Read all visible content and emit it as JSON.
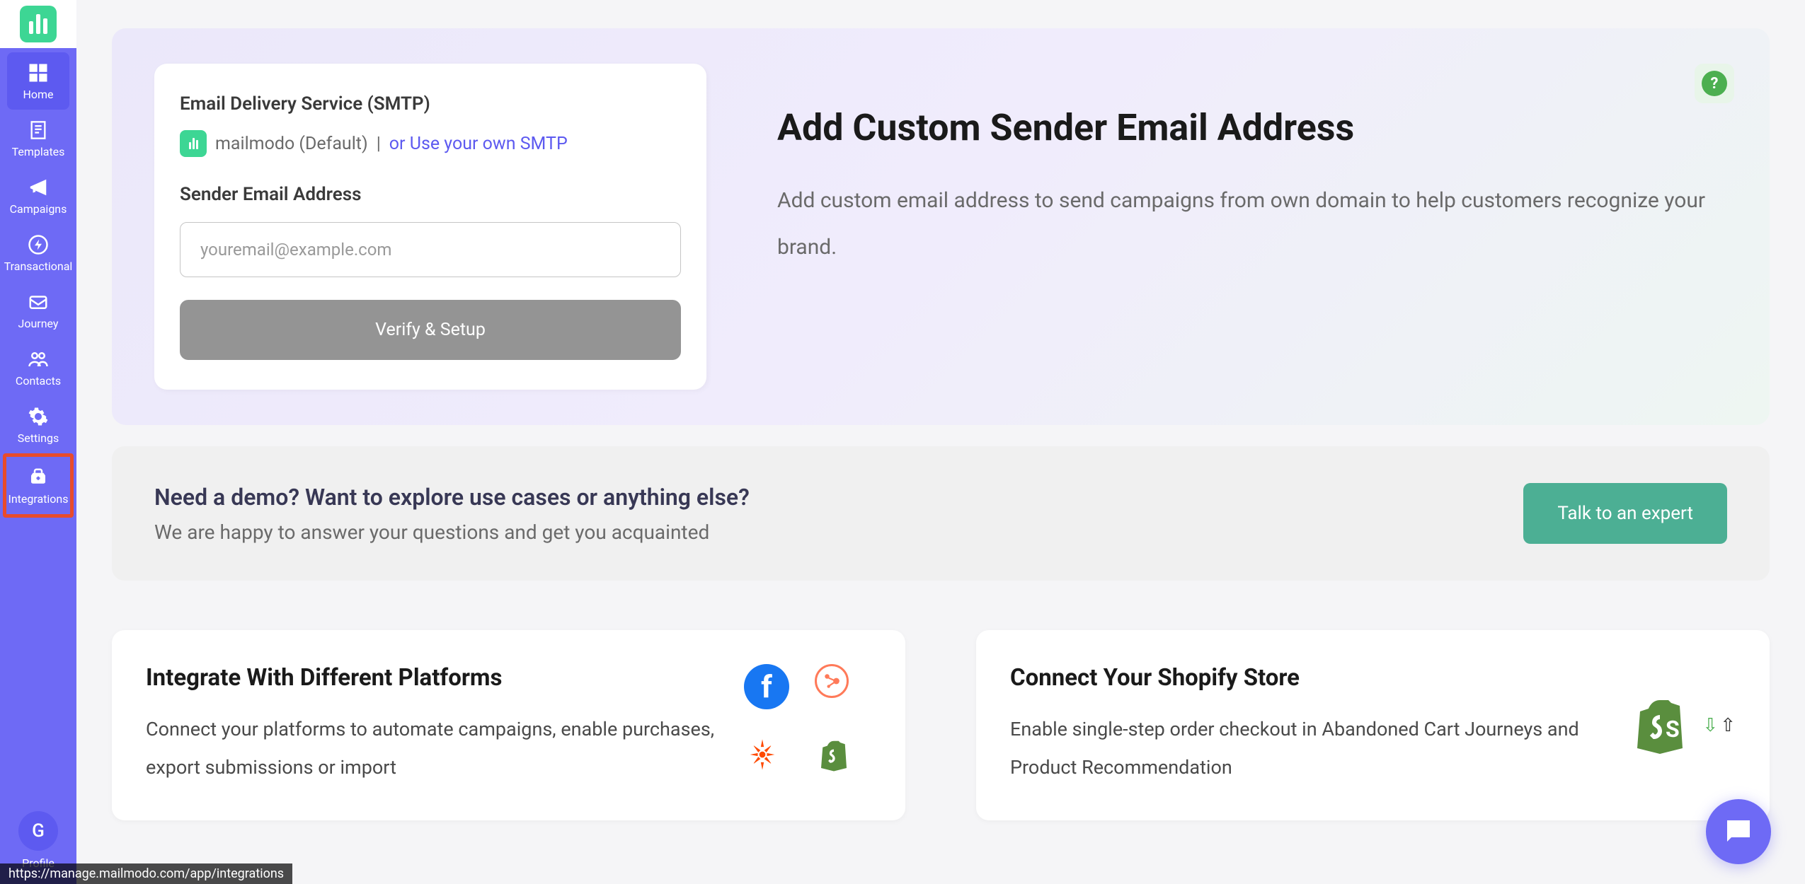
{
  "sidebar": {
    "items": [
      {
        "label": "Home"
      },
      {
        "label": "Templates"
      },
      {
        "label": "Campaigns"
      },
      {
        "label": "Transactional"
      },
      {
        "label": "Journey"
      },
      {
        "label": "Contacts"
      },
      {
        "label": "Settings"
      },
      {
        "label": "Integrations"
      }
    ],
    "profile": {
      "initial": "G",
      "label": "Profile"
    }
  },
  "sender_section": {
    "smtp_label": "Email Delivery Service (SMTP)",
    "smtp_default": "mailmodo (Default)",
    "smtp_pipe": "|",
    "smtp_link": "or Use your own SMTP",
    "address_label": "Sender Email Address",
    "email_placeholder": "youremail@example.com",
    "verify_button": "Verify & Setup",
    "title": "Add Custom Sender Email Address",
    "description": "Add custom email address to send campaigns from own domain to help customers recognize your brand.",
    "help_text": "?"
  },
  "demo_section": {
    "title": "Need a demo? Want to explore use cases or anything else?",
    "subtitle": "We are happy to answer your questions and get you acquainted",
    "button": "Talk to an expert"
  },
  "integrate_card": {
    "title": "Integrate With Different Platforms",
    "description": "Connect your platforms to automate campaigns, enable purchases, export submissions or import"
  },
  "shopify_card": {
    "title": "Connect Your Shopify Store",
    "description": "Enable single-step order checkout in Abandoned Cart Journeys and Product Recommendation"
  },
  "status_url": "https://manage.mailmodo.com/app/integrations"
}
